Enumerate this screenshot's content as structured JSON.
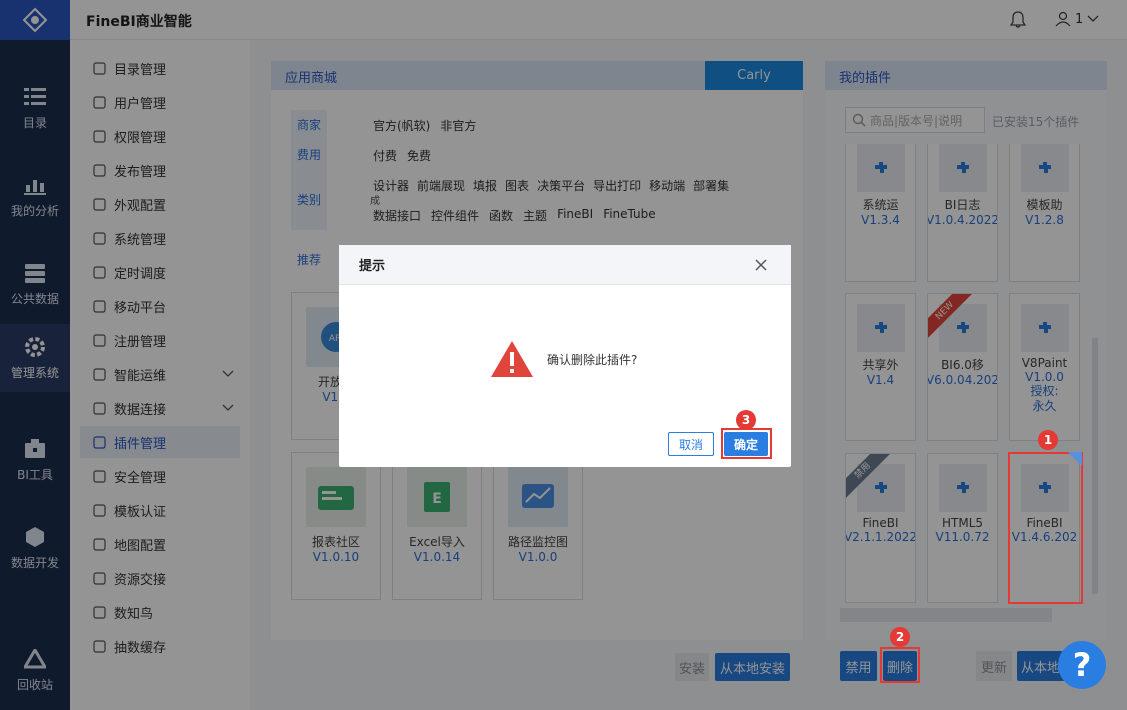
{
  "app": {
    "title": "FineBI商业智能",
    "user_label": "1"
  },
  "rail": [
    {
      "label": "目录",
      "icon": "catalog-icon"
    },
    {
      "label": "我的分析",
      "icon": "analysis-icon"
    },
    {
      "label": "公共数据",
      "icon": "public-data-icon"
    },
    {
      "label": "管理系统",
      "icon": "gear-icon",
      "active": true
    },
    {
      "label": "BI工具",
      "icon": "toolbox-icon"
    },
    {
      "label": "数据开发",
      "icon": "cube-icon"
    },
    {
      "label": "回收站",
      "icon": "recycle-icon"
    }
  ],
  "menu": [
    {
      "label": "目录管理"
    },
    {
      "label": "用户管理"
    },
    {
      "label": "权限管理"
    },
    {
      "label": "发布管理"
    },
    {
      "label": "外观配置"
    },
    {
      "label": "系统管理"
    },
    {
      "label": "定时调度"
    },
    {
      "label": "移动平台"
    },
    {
      "label": "注册管理"
    },
    {
      "label": "智能运维"
    },
    {
      "label": "数据连接"
    },
    {
      "label": "插件管理"
    },
    {
      "label": "安全管理"
    },
    {
      "label": "模板认证"
    },
    {
      "label": "地图配置"
    },
    {
      "label": "资源交接"
    },
    {
      "label": "数知鸟"
    },
    {
      "label": "抽数缓存"
    }
  ],
  "store": {
    "title": "应用商城",
    "tab": "Carly",
    "filters": {
      "vendor_label": "商家",
      "vendor_opts": [
        "官方(帆软)",
        "非官方"
      ],
      "fee_label": "费用",
      "fee_opts": [
        "付费",
        "免费"
      ],
      "cat_label": "类别",
      "cat_row1": [
        "设计器",
        "前端展现",
        "填报",
        "图表",
        "决策平台",
        "导出打印",
        "移动端",
        "部署集"
      ],
      "cat_row2": [
        "数据接口",
        "控件组件",
        "函数",
        "主题",
        "FineBI",
        "FineTube"
      ],
      "overflow": "成"
    },
    "recommend": "推荐",
    "cards": [
      {
        "name": "开放平",
        "version": "V1.3"
      },
      {
        "name": "报表社区",
        "version": "V1.0.10"
      },
      {
        "name": "Excel导入",
        "version": "V1.0.14"
      },
      {
        "name": "路径监控图",
        "version": "V1.0.0"
      }
    ],
    "install": "安装",
    "install_local": "从本地安装"
  },
  "mine": {
    "title": "我的插件",
    "search_placeholder": "商品|版本号|说明",
    "installed": "已安装15个插件",
    "plugins": [
      {
        "name": "系统运",
        "version": "V1.3.4"
      },
      {
        "name": "BI日志",
        "version": "V1.0.4.2022"
      },
      {
        "name": "模板助",
        "version": "V1.2.8"
      },
      {
        "name": "共享外",
        "version": "V1.4"
      },
      {
        "name": "BI6.0移",
        "version": "V6.0.04.202",
        "ribbon": "NEW"
      },
      {
        "name": "V8Paint",
        "version": "V1.0.0",
        "extra": "授权:永久"
      },
      {
        "name": "FineBI",
        "version": "V2.1.1.2022",
        "ribbon": "禁用"
      },
      {
        "name": "HTML5",
        "version": "V11.0.72"
      },
      {
        "name": "FineBI",
        "version": "V1.4.6.202"
      }
    ],
    "disable": "禁用",
    "delete": "删除",
    "update": "更新",
    "install_local": "从本地"
  },
  "dialog": {
    "title": "提示",
    "message": "确认删除此插件?",
    "cancel": "取消",
    "confirm": "确定"
  },
  "markers": [
    "1",
    "2",
    "3"
  ],
  "help": "?",
  "colors": {
    "accent": "#2a7de1",
    "rail": "#1d2d4f",
    "marker": "#e53935"
  }
}
